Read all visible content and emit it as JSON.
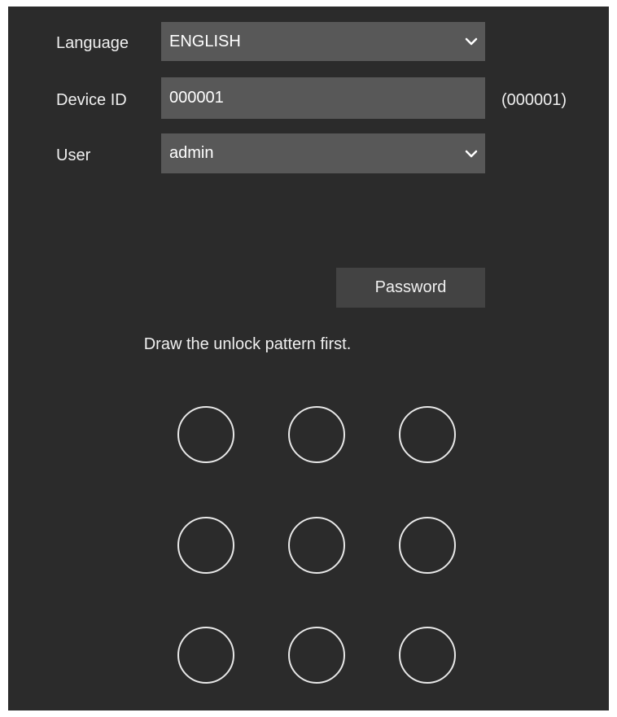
{
  "login": {
    "language": {
      "label": "Language",
      "value": "ENGLISH"
    },
    "device_id": {
      "label": "Device ID",
      "value": "000001",
      "hint": "(000001)"
    },
    "user": {
      "label": "User",
      "value": "admin"
    },
    "password_button": "Password",
    "pattern_prompt": "Draw the unlock pattern first."
  },
  "pattern": {
    "rows": 3,
    "cols": 3
  },
  "icons": {
    "dropdown": "chevron-down-icon",
    "pattern_dot": "circle-outline"
  },
  "colors": {
    "panel_bg": "#2b2b2b",
    "field_bg": "#585858",
    "button_bg": "#434343",
    "text": "#f0f0f0",
    "pattern_ring": "#e8e8e8"
  }
}
